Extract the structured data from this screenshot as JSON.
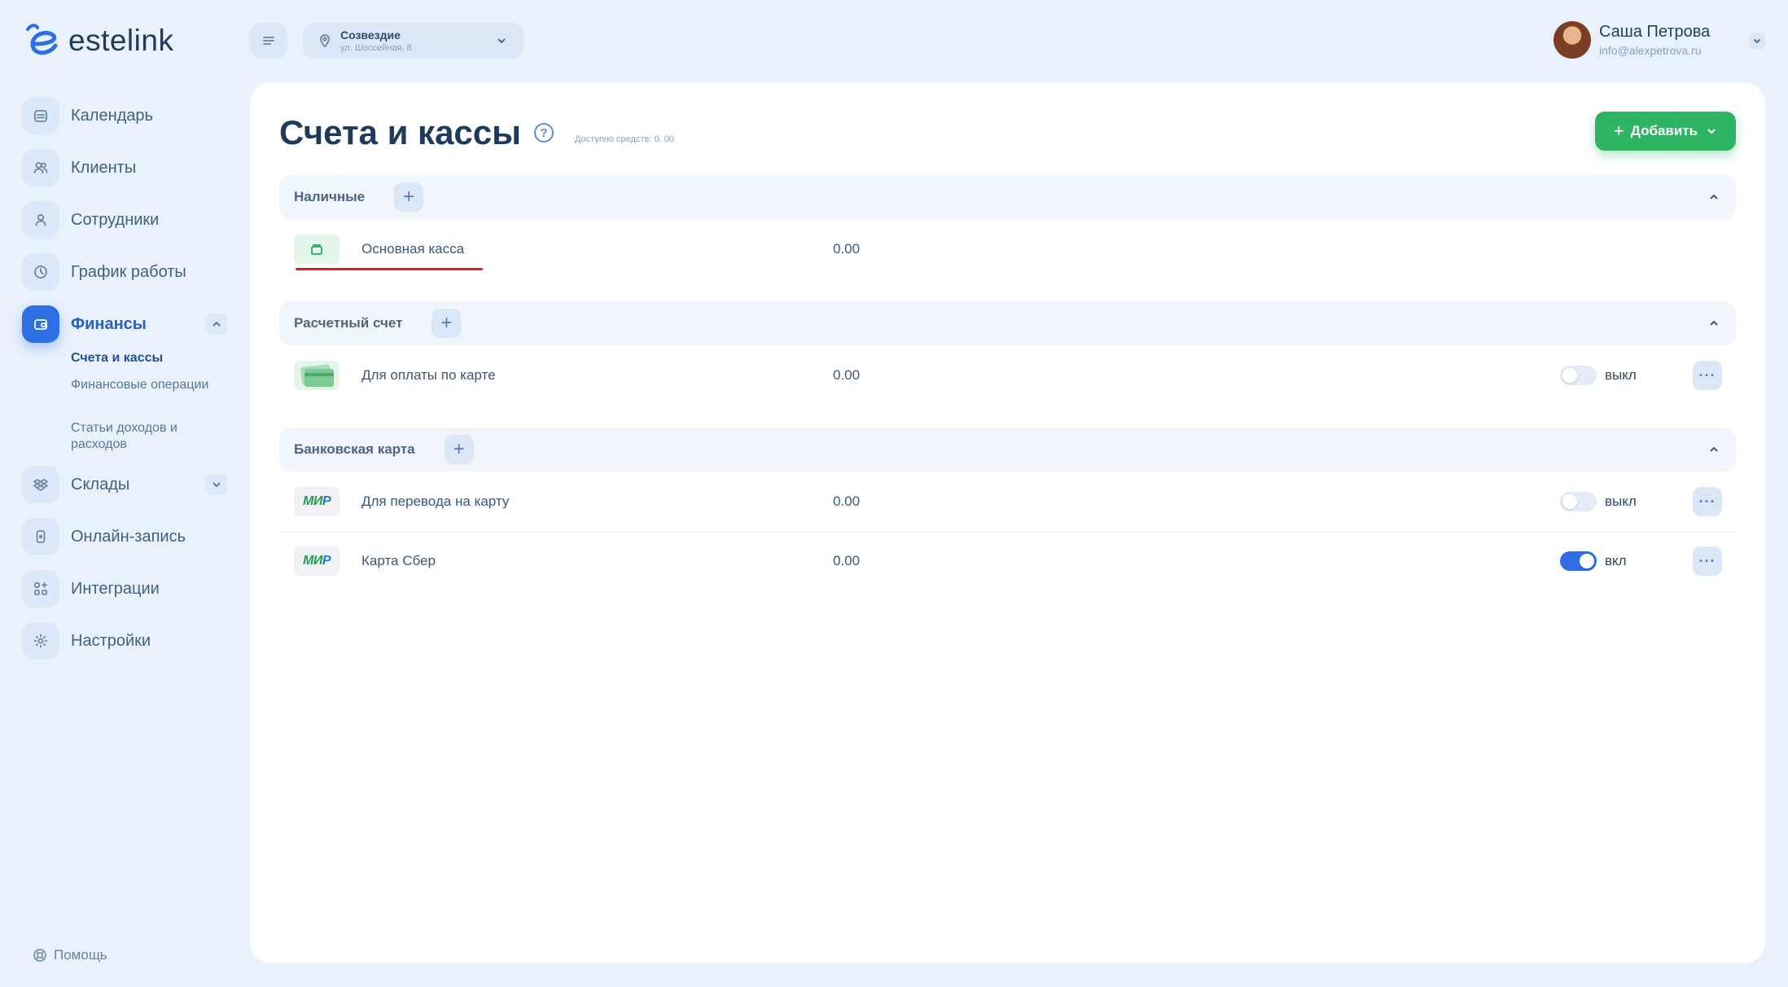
{
  "app": {
    "logo_text": "estelink"
  },
  "sidebar": {
    "items": [
      {
        "label": "Календарь"
      },
      {
        "label": "Клиенты"
      },
      {
        "label": "Сотрудники"
      },
      {
        "label": "График работы"
      },
      {
        "label": "Финансы"
      },
      {
        "label": "Склады"
      },
      {
        "label": "Онлайн-запись"
      },
      {
        "label": "Интеграции"
      },
      {
        "label": "Настройки"
      }
    ],
    "finance_sub": [
      {
        "label": "Счета и кассы"
      },
      {
        "label": "Финансовые операции"
      },
      {
        "label": "Статьи доходов и расходов"
      }
    ],
    "help_label": "Помощь"
  },
  "topbar": {
    "branch_name": "Созвездие",
    "branch_address": "ул. Шоссейная, 8",
    "user_name": "Саша Петрова",
    "user_email": "info@alexpetrova.ru"
  },
  "main": {
    "title": "Счета и кассы",
    "help_symbol": "?",
    "available": "Доступно средств: 0. 00",
    "add_button": "Добавить",
    "sections": [
      {
        "title": "Наличные",
        "accounts": [
          {
            "name": "Основная касса",
            "balance": "0.00"
          }
        ]
      },
      {
        "title": "Расчетный счет",
        "accounts": [
          {
            "name": "Для оплаты по карте",
            "balance": "0.00",
            "toggle": "выкл"
          }
        ]
      },
      {
        "title": "Банковская карта",
        "accounts": [
          {
            "name": "Для перевода на карту",
            "balance": "0.00",
            "toggle": "выкл",
            "logo_main": "МИ",
            "logo_tail": "Р"
          },
          {
            "name": "Карта Сбер",
            "balance": "0.00",
            "toggle": "вкл",
            "logo_main": "МИ",
            "logo_tail": "Р"
          }
        ]
      }
    ]
  },
  "colors": {
    "accent": "#2f6fe4",
    "add_button": "#2fb463",
    "highlight_underline": "#e41e1e"
  }
}
